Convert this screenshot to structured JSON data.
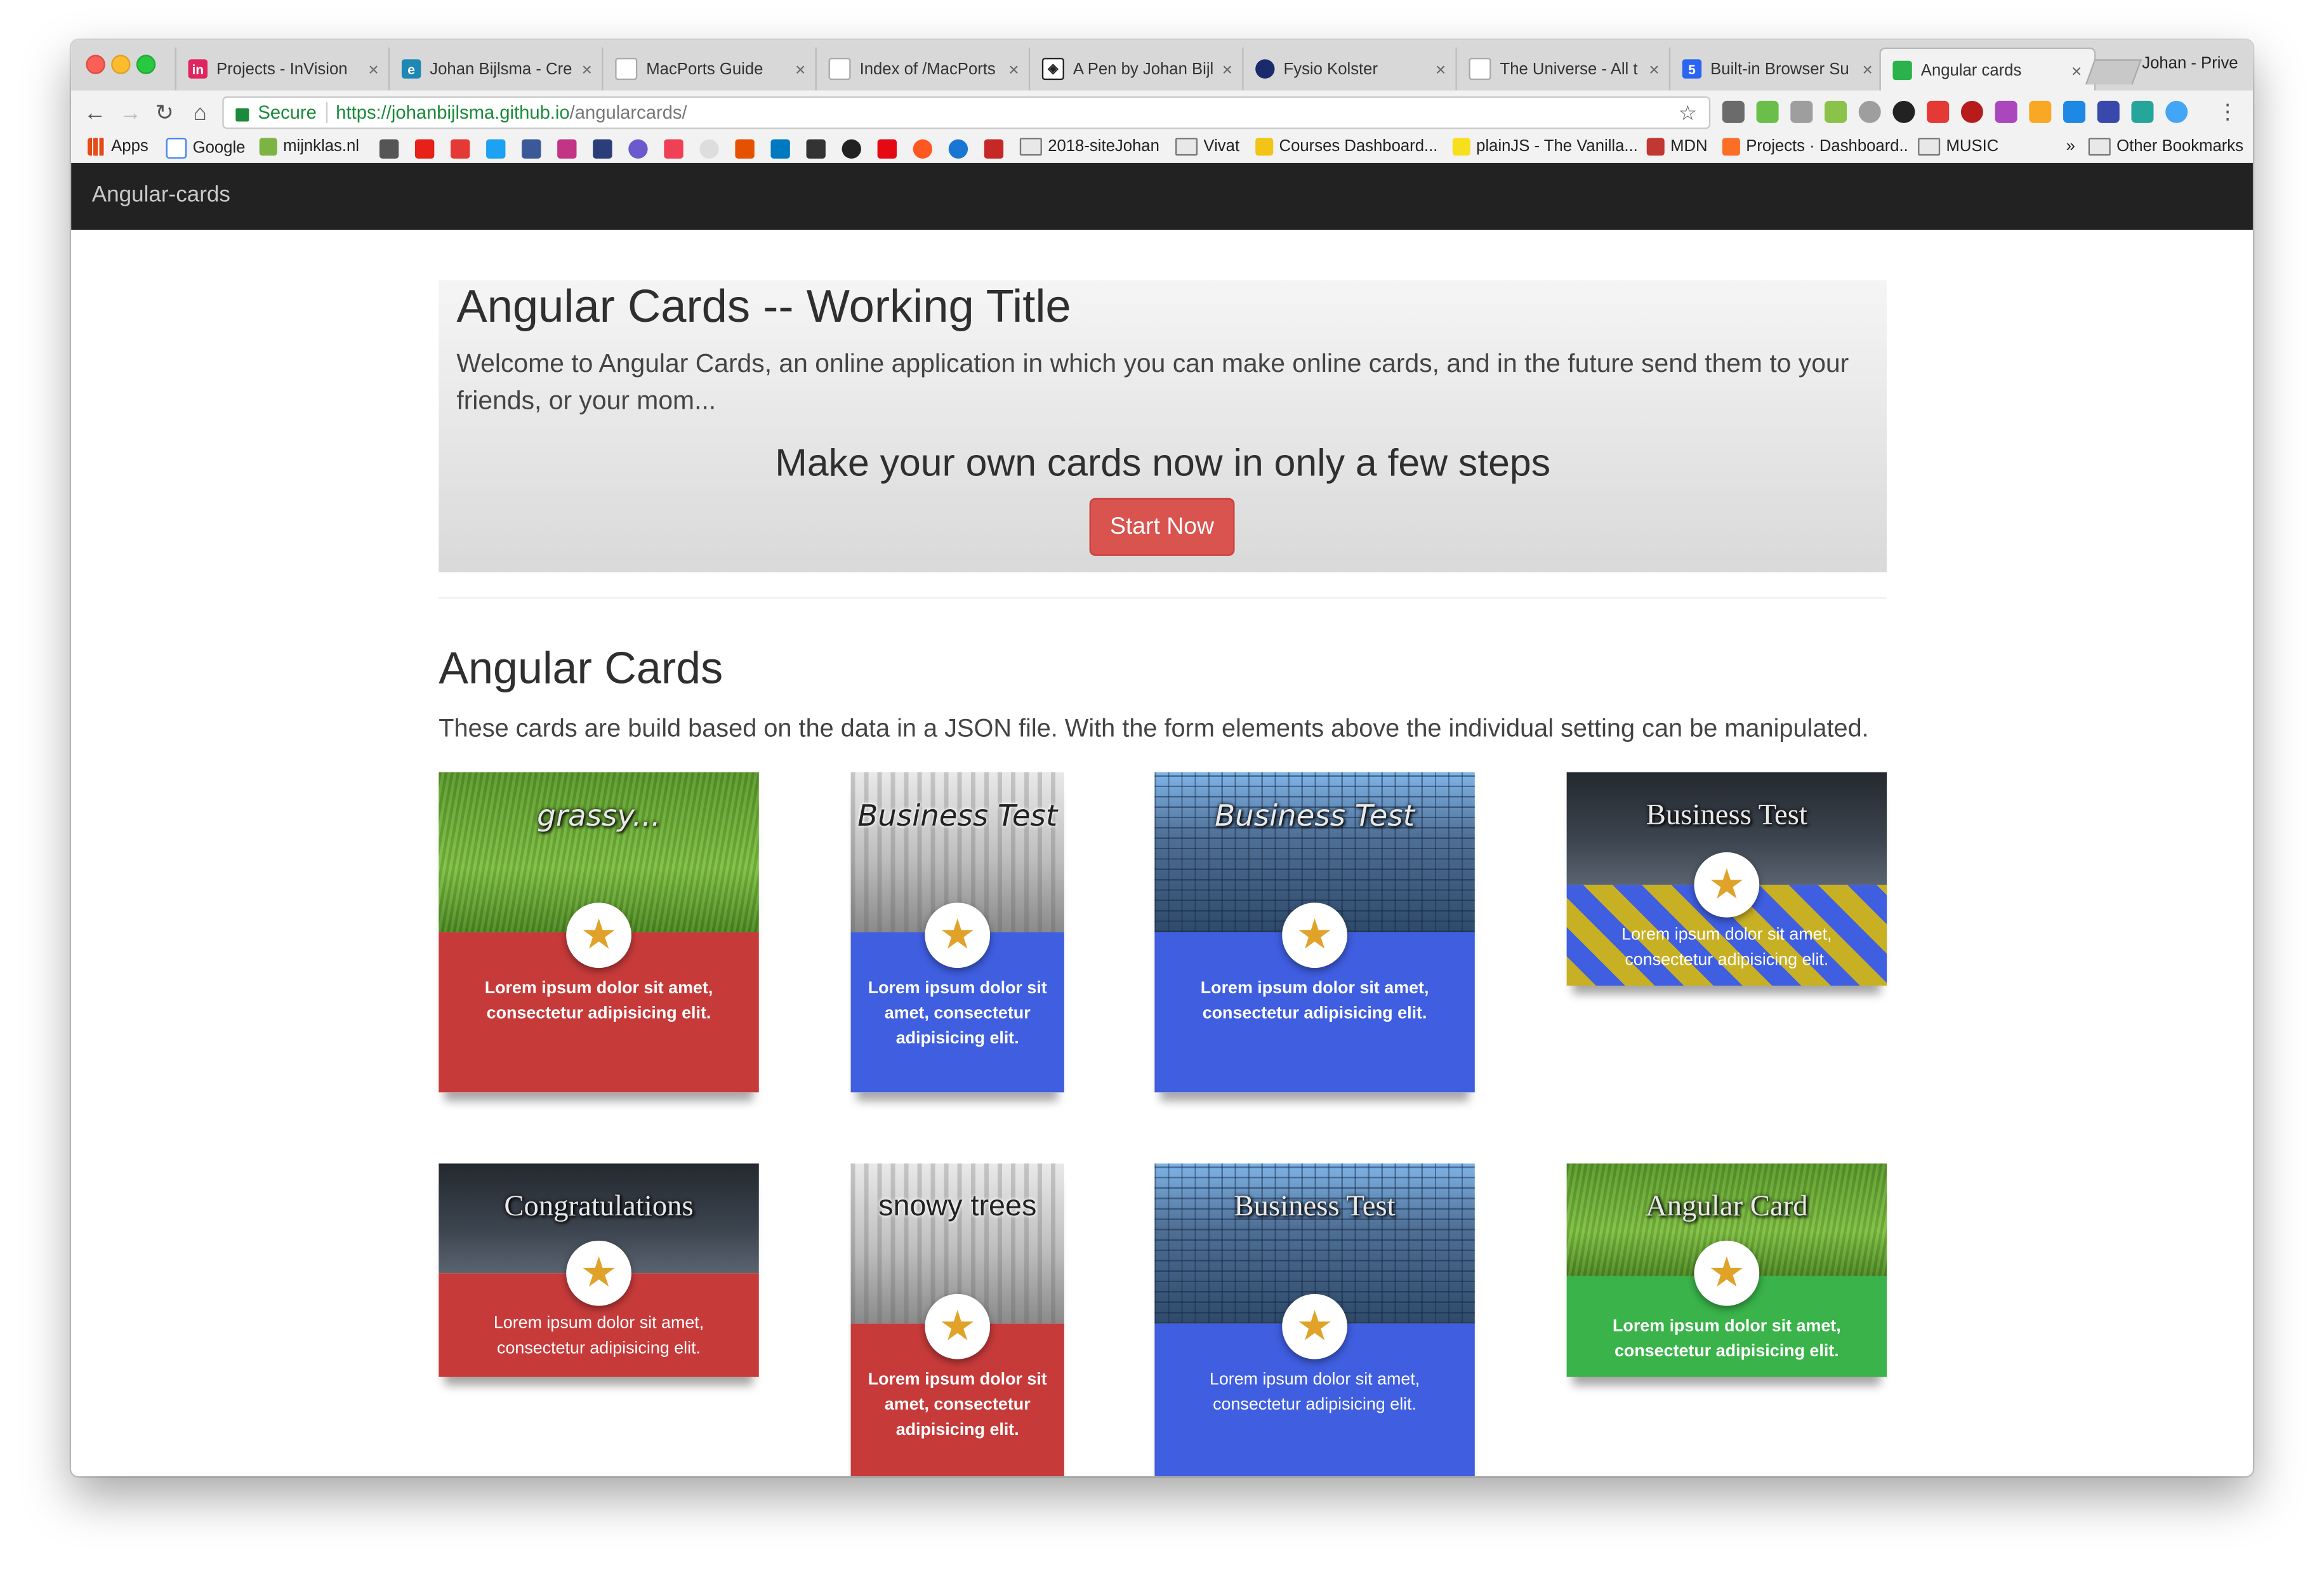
{
  "browser": {
    "tabs": [
      {
        "label": "Projects - InVision",
        "favicon_color": "#e0245e",
        "favicon_glyph": "in"
      },
      {
        "label": "Johan Bijlsma - Cre",
        "favicon_color": "#1e88b4",
        "favicon_glyph": "e"
      },
      {
        "label": "MacPorts Guide",
        "favicon_color": "#aaaaaa",
        "favicon_glyph": ""
      },
      {
        "label": "Index of /MacPorts",
        "favicon_color": "#aaaaaa",
        "favicon_glyph": ""
      },
      {
        "label": "A Pen by Johan Bijl",
        "favicon_color": "#222222",
        "favicon_glyph": "◈"
      },
      {
        "label": "Fysio Kolster",
        "favicon_color": "#1a2a6c",
        "favicon_glyph": "●"
      },
      {
        "label": "The Universe - All t",
        "favicon_color": "#aaaaaa",
        "favicon_glyph": ""
      },
      {
        "label": "Built-in Browser Su",
        "favicon_color": "#2965f1",
        "favicon_glyph": "5"
      },
      {
        "label": "Angular cards",
        "favicon_color": "#2bb24c",
        "favicon_glyph": "◉"
      }
    ],
    "profile": "Johan - Prive",
    "address": {
      "secure_label": "Secure",
      "host": "https://johanbijlsma.github.io",
      "path": "/angularcards/"
    },
    "bookmarks": [
      {
        "label": "Apps",
        "color": "#e64a19"
      },
      {
        "label": "Google",
        "color": "#4285f4"
      },
      {
        "label": "mijnklas.nl",
        "color": "#7cb342"
      },
      {
        "label": "2018-siteJohan",
        "color": "folder"
      },
      {
        "label": "Vivat",
        "color": "folder"
      },
      {
        "label": "Courses Dashboard...",
        "color": "#f2c417"
      },
      {
        "label": "plainJS - The Vanilla...",
        "color": "#f7df1e"
      },
      {
        "label": "MDN",
        "color": "#c13832"
      },
      {
        "label": "Projects · Dashboard..",
        "color": "#fc6d26"
      },
      {
        "label": "MUSIC",
        "color": "folder"
      },
      {
        "label": "Other Bookmarks",
        "color": "folder"
      }
    ],
    "bookmark_overflow": "»"
  },
  "app": {
    "brand": "Angular-cards",
    "jumbotron": {
      "title": "Angular Cards -- Working Title",
      "lead": "Welcome to Angular Cards, an online application in which you can make online cards, and in the future send them to your friends, or your mom...",
      "cta_heading": "Make your own cards now in only a few steps",
      "cta_button": "Start Now"
    },
    "section": {
      "title": "Angular Cards",
      "description": "These cards are build based on the data in a JSON file. With the form elements above the individual setting can be manipulated."
    },
    "cards": [
      {
        "title": "grassy...",
        "text": "Lorem ipsum dolor sit amet, consectetur adipisicing elit.",
        "image": "grass",
        "color": "red",
        "font": "hand"
      },
      {
        "title": "Business Test",
        "text": "Lorem ipsum dolor sit amet, consectetur adipisicing elit.",
        "image": "snow",
        "color": "blue",
        "font": "hand-dark"
      },
      {
        "title": "Business Test",
        "text": "Lorem ipsum dolor sit amet, consectetur adipisicing elit.",
        "image": "tower",
        "color": "blue",
        "font": "hand"
      },
      {
        "title": "Business Test",
        "text": "Lorem ipsum dolor sit amet, consectetur adipisicing elit.",
        "image": "storm",
        "color": "hazard",
        "font": "serif"
      },
      {
        "title": "Congratulations",
        "text": "Lorem ipsum dolor sit amet, consectetur adipisicing elit.",
        "image": "storm",
        "color": "red",
        "font": "serif"
      },
      {
        "title": "snowy trees",
        "text": "Lorem ipsum dolor sit amet, consectetur adipisicing elit.",
        "image": "snow",
        "color": "red",
        "font": "sans-dark"
      },
      {
        "title": "Business Test",
        "text": "Lorem ipsum dolor sit amet, consectetur adipisicing elit.",
        "image": "tower",
        "color": "blue",
        "font": "serif"
      },
      {
        "title": "Angular Card",
        "text": "Lorem ipsum dolor sit amet, consectetur adipisicing elit.",
        "image": "grass",
        "color": "green",
        "font": "serif"
      }
    ],
    "badge_icon": "star-icon"
  }
}
